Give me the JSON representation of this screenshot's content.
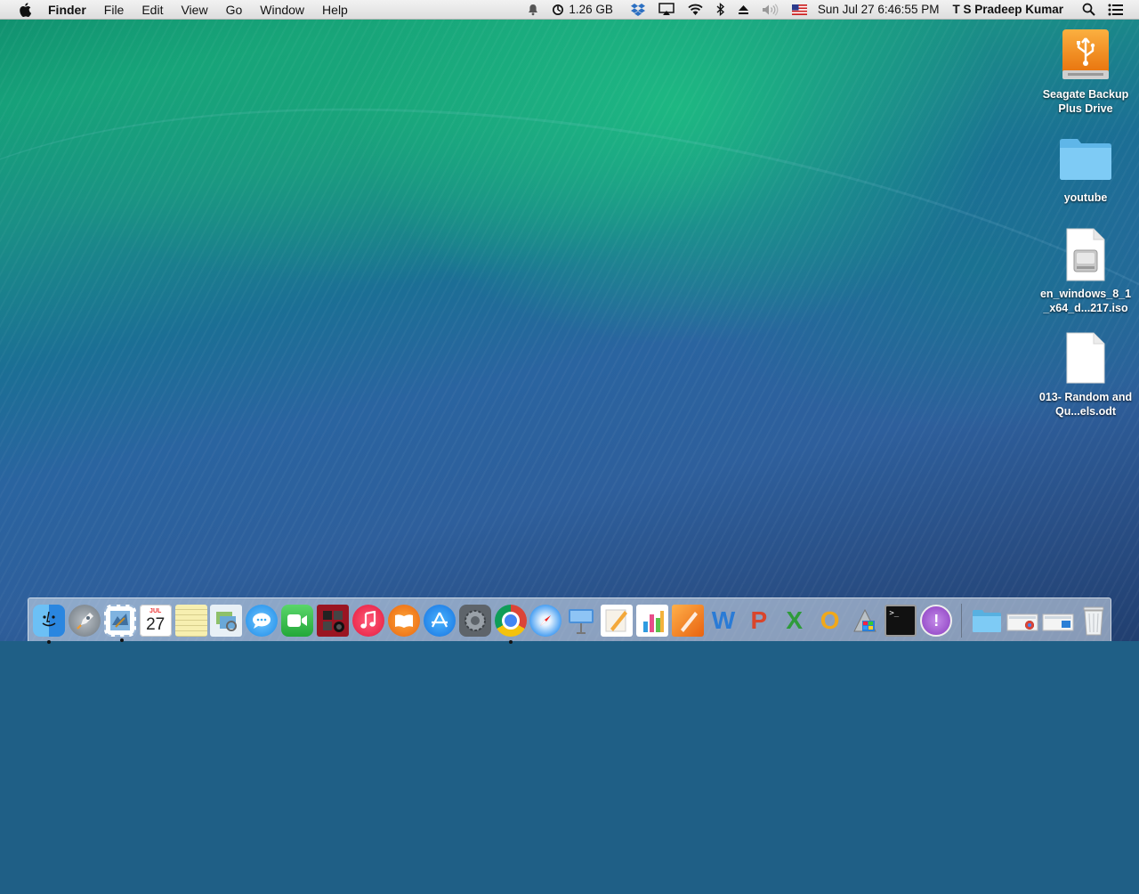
{
  "menubar": {
    "app_name": "Finder",
    "menus": [
      "File",
      "Edit",
      "View",
      "Go",
      "Window",
      "Help"
    ],
    "memory": "1.26 GB",
    "datetime": "Sun Jul 27  6:46:55 PM",
    "user": "T S Pradeep Kumar",
    "status_icons": [
      "notification-bell-icon",
      "memory-gauge-icon",
      "dropbox-icon",
      "airplay-icon",
      "wifi-icon",
      "bluetooth-icon",
      "eject-icon",
      "volume-icon",
      "us-flag-icon",
      "spotlight-icon",
      "notification-center-icon"
    ]
  },
  "desktop": {
    "icons": [
      {
        "label": "Seagate Backup Plus Drive",
        "icon": "usb-drive-icon"
      },
      {
        "label": "youtube",
        "icon": "folder-icon"
      },
      {
        "label": "en_windows_8_1_x64_d...217.iso",
        "icon": "disk-image-icon"
      },
      {
        "label": "013- Random and Qu...els.odt",
        "icon": "document-icon"
      }
    ]
  },
  "dock": {
    "calendar_month": "JUL",
    "calendar_day": "27",
    "apps": [
      {
        "icon": "finder-icon",
        "running": true,
        "color": "#3b8fe0"
      },
      {
        "icon": "launchpad-icon",
        "running": false,
        "color": "#8a9299"
      },
      {
        "icon": "mail-stamp-icon",
        "running": true,
        "color": "#6aa0d8"
      },
      {
        "icon": "calendar-icon",
        "running": false,
        "color": "#ffffff"
      },
      {
        "icon": "notes-icon",
        "running": false,
        "color": "#f7efb0"
      },
      {
        "icon": "preview-icon",
        "running": false,
        "color": "#d6e8f5"
      },
      {
        "icon": "messages-icon",
        "running": false,
        "color": "#3aa8f0"
      },
      {
        "icon": "facetime-icon",
        "running": false,
        "color": "#3dc34f"
      },
      {
        "icon": "photo-booth-icon",
        "running": false,
        "color": "#b3192b"
      },
      {
        "icon": "itunes-icon",
        "running": false,
        "color": "#ef2b4a"
      },
      {
        "icon": "ibooks-icon",
        "running": false,
        "color": "#f57a1a"
      },
      {
        "icon": "app-store-icon",
        "running": false,
        "color": "#2f8ff0"
      },
      {
        "icon": "system-preferences-icon",
        "running": false,
        "color": "#777d84"
      },
      {
        "icon": "chrome-icon",
        "running": true,
        "color": "#ffffff"
      },
      {
        "icon": "safari-icon",
        "running": false,
        "color": "#1e8ef0"
      },
      {
        "icon": "keynote-icon",
        "running": false,
        "color": "#4a90d9"
      },
      {
        "icon": "pages-icon",
        "running": false,
        "color": "#f3b34b"
      },
      {
        "icon": "numbers-icon",
        "running": false,
        "color": "#55b84a"
      },
      {
        "icon": "ibooks-author-icon",
        "running": false,
        "color": "#f08a30"
      },
      {
        "icon": "word-icon",
        "running": false,
        "color": "#2a7bd6",
        "glyph": "W"
      },
      {
        "icon": "powerpoint-icon",
        "running": false,
        "color": "#d9452b",
        "glyph": "P"
      },
      {
        "icon": "excel-icon",
        "running": false,
        "color": "#2e9b3a",
        "glyph": "X"
      },
      {
        "icon": "outlook-icon",
        "running": false,
        "color": "#f0a81a",
        "glyph": "O"
      },
      {
        "icon": "boot-camp-assistant-icon",
        "running": false,
        "color": "#9aa3ab"
      },
      {
        "icon": "terminal-icon",
        "running": false,
        "color": "#1a1a1a"
      },
      {
        "icon": "feedback-assistant-icon",
        "running": false,
        "color": "#9a4cc8"
      }
    ],
    "stacks": [
      {
        "icon": "applications-folder-icon",
        "color": "#6cc3f0"
      },
      {
        "icon": "downloads-stack-icon",
        "color": "#f2f2f2"
      },
      {
        "icon": "documents-stack-icon",
        "color": "#f2f2f2"
      },
      {
        "icon": "trash-icon",
        "color": "#dfe3e6"
      }
    ]
  }
}
